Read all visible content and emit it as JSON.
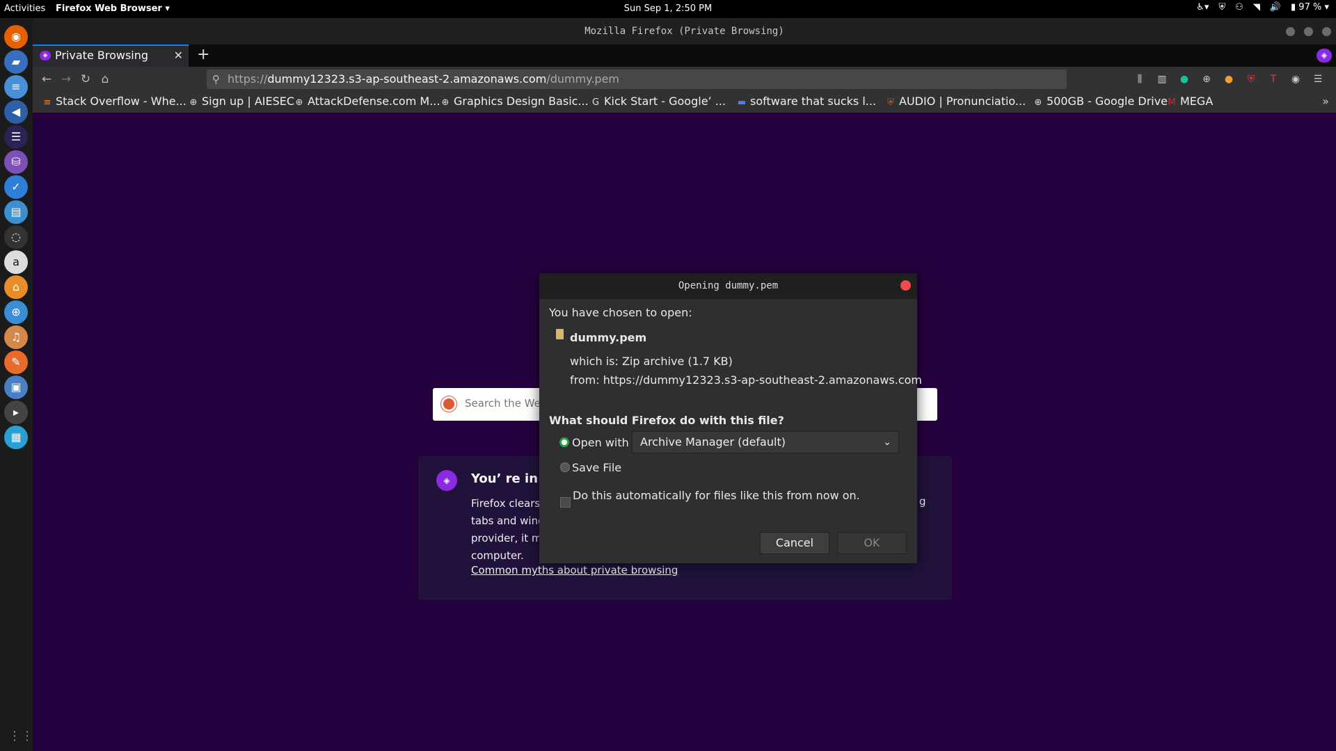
{
  "topbar": {
    "activities": "Activities",
    "app_menu": "Firefox Web Browser ▾",
    "clock": "Sun Sep  1,  2:50 PM",
    "battery": "97 %"
  },
  "dock": {
    "icons": [
      "firefox-icon",
      "files-icon",
      "text-editor-icon",
      "vscode-icon",
      "eclipse-icon",
      "database-icon",
      "tasks-icon",
      "remote-desktop-icon",
      "obs-icon",
      "amazon-icon",
      "software-center-icon",
      "help-icon",
      "sound-icon",
      "screenshot-icon",
      "network-icon",
      "terminal-icon",
      "system-monitor-icon"
    ]
  },
  "window": {
    "title": "Mozilla Firefox (Private Browsing)"
  },
  "tab": {
    "label": "Private Browsing",
    "close": "✕",
    "new": "+"
  },
  "url": {
    "prefix": "https://",
    "host": "dummy12323.s3-ap-southeast-2.amazonaws.com",
    "path": "/dummy.pem"
  },
  "bookmarks": [
    {
      "label": "Stack Overflow - Whe...",
      "icon": "stackoverflow-icon"
    },
    {
      "label": "Sign up | AIESEC",
      "icon": "globe-icon"
    },
    {
      "label": "AttackDefense.com M...",
      "icon": "globe-icon"
    },
    {
      "label": "Graphics Design Basic...",
      "icon": "globe-icon"
    },
    {
      "label": "Kick Start - Google’ ...",
      "icon": "google-icon"
    },
    {
      "label": "software that sucks l...",
      "icon": "bookmark-icon"
    },
    {
      "label": "AUDIO | Pronunciatio...",
      "icon": "cambridge-icon"
    },
    {
      "label": "500GB - Google Drive",
      "icon": "globe-icon"
    },
    {
      "label": "MEGA",
      "icon": "mega-icon"
    }
  ],
  "page": {
    "search_placeholder": "Search the Web",
    "card_heading": "You’ re in a",
    "card_body_lines": [
      "Firefox clears y",
      "tabs and windo",
      "provider, it mal",
      "computer."
    ],
    "card_body_right": "g",
    "myths_link": "Common myths about private browsing"
  },
  "dialog": {
    "title": "Opening dummy.pem",
    "chosen": "You have chosen to open:",
    "filename": "dummy.pem",
    "which_is": "which is: Zip archive (1.7 KB)",
    "from": "from: https://dummy12323.s3-ap-southeast-2.amazonaws.com",
    "question": "What should Firefox do with this file?",
    "open_with": "Open with",
    "app": "Archive Manager (default)",
    "save_file": "Save File",
    "auto": "Do this automatically for files like this from now on.",
    "cancel": "Cancel",
    "ok": "OK"
  },
  "colors": {
    "page_bg": "#25003e",
    "accent": "#0a84ff",
    "private_purple": "#8a2be2",
    "radio_green": "#25a548",
    "close_red": "#f04a4a"
  }
}
